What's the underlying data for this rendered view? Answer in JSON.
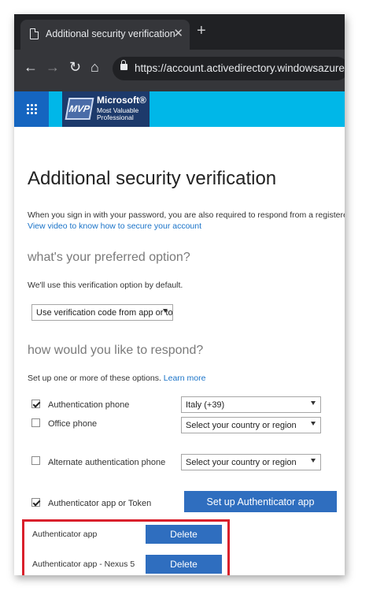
{
  "browser": {
    "tab_title": "Additional security verification",
    "tab_close": "✕",
    "new_tab": "+",
    "url": "https://account.activedirectory.windowsazure.com"
  },
  "header": {
    "logo_badge": "MVP",
    "logo_line1": "Microsoft®",
    "logo_line2": "Most Valuable",
    "logo_line3": "Professional"
  },
  "page": {
    "title": "Additional security verification",
    "intro": "When you sign in with your password, you are also required to respond from a registered device",
    "video_link": "View video to know how to secure your account"
  },
  "preferred": {
    "heading": "what's your preferred option?",
    "description": "We'll use this verification option by default.",
    "selected": "Use verification code from app or token"
  },
  "respond": {
    "heading": "how would you like to respond?",
    "description": "Set up one or more of these options.",
    "learn_more": "Learn more",
    "options": [
      {
        "label": "Authentication phone",
        "checked": true,
        "country": "Italy (+39)"
      },
      {
        "label": "Office phone",
        "checked": false,
        "country": "Select your country or region"
      },
      {
        "label": "Alternate authentication phone",
        "checked": false,
        "country": "Select your country or region"
      },
      {
        "label": "Authenticator app or Token",
        "checked": true,
        "button": "Set up Authenticator app"
      }
    ]
  },
  "apps": [
    {
      "name": "Authenticator app",
      "action": "Delete"
    },
    {
      "name": "Authenticator app - Nexus 5",
      "action": "Delete"
    }
  ],
  "colors": {
    "azure_bar": "#00b7e8",
    "waffle": "#1565c0",
    "primary_button": "#2f6ebf",
    "link": "#1a73c8",
    "highlight_border": "#d9202b"
  }
}
